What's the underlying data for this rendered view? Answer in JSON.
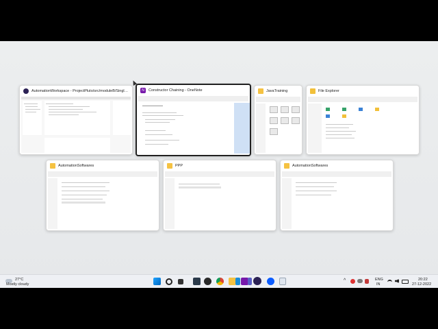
{
  "windows": [
    {
      "title": "AutomationWorkspace - ProjectPluto/src/moduleB/Single...",
      "icon": "eclipse-icon"
    },
    {
      "title": "Constructor Chaining - OneNote",
      "icon": "onenote-icon",
      "selected": true
    },
    {
      "title": "JavaTraining",
      "icon": "folder-icon"
    },
    {
      "title": "File Explorer",
      "icon": "file-explorer-icon"
    },
    {
      "title": "AutomationSoftwares",
      "icon": "folder-icon"
    },
    {
      "title": "PPP",
      "icon": "folder-icon"
    },
    {
      "title": "AutomationSoftwares",
      "icon": "folder-icon"
    }
  ],
  "weather": {
    "temp": "27°C",
    "condition": "Mostly cloudy"
  },
  "tray": {
    "lang_top": "ENG",
    "lang_bottom": "IN",
    "time": "20:22",
    "date": "27-12-2022"
  },
  "colors": {
    "accent": "#0067c0",
    "taskbar": "#eef0f4",
    "desktop": "#e8eaec"
  }
}
